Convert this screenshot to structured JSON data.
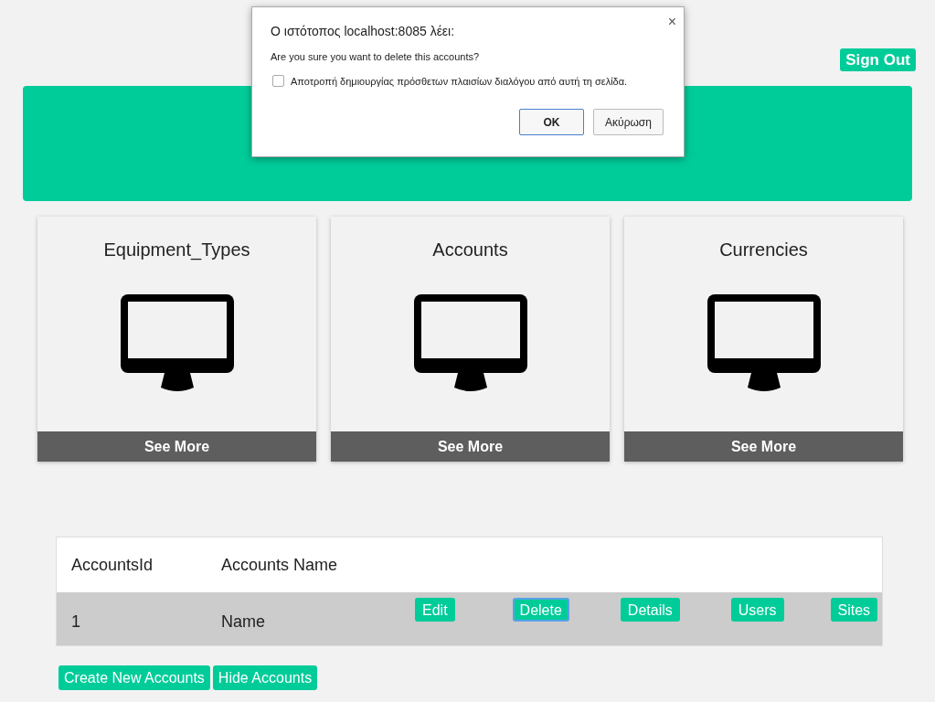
{
  "header": {
    "sign_out": "Sign Out"
  },
  "cards": [
    {
      "title": "Equipment_Types",
      "button": "See More"
    },
    {
      "title": "Accounts",
      "button": "See More"
    },
    {
      "title": "Currencies",
      "button": "See More"
    }
  ],
  "table": {
    "columns": [
      "AccountsId",
      "Accounts Name"
    ],
    "rows": [
      {
        "cells": [
          "1",
          "Name"
        ],
        "actions": [
          {
            "label": "Edit",
            "focused": false
          },
          {
            "label": "Delete",
            "focused": true
          },
          {
            "label": "Details",
            "focused": false
          },
          {
            "label": "Users",
            "focused": false
          },
          {
            "label": "Sites",
            "focused": false
          }
        ]
      }
    ]
  },
  "footer_buttons": [
    "Create New Accounts",
    "Hide Accounts"
  ],
  "dialog": {
    "title": "Ο ιστότοπος localhost:8085 λέει:",
    "message": "Are you sure you want to delete this accounts?",
    "checkbox": {
      "label": "Αποτροπή δημιουργίας πρόσθετων πλαισίων διαλόγου από αυτή τη σελίδα.",
      "checked": false
    },
    "close": "×",
    "buttons": [
      {
        "label": "OK",
        "default": true
      },
      {
        "label": "Ακύρωση",
        "default": false
      }
    ]
  }
}
